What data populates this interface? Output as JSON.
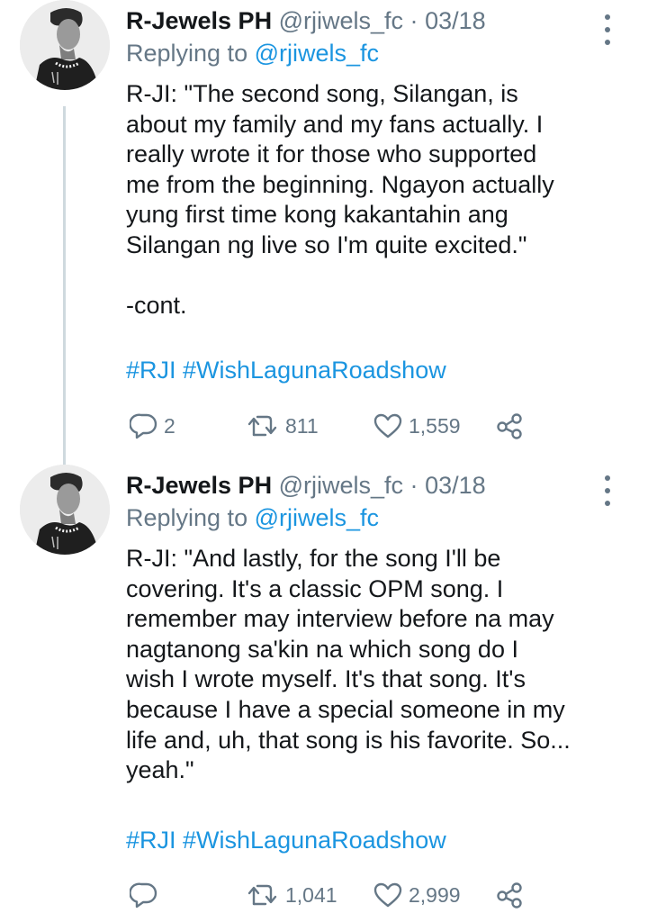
{
  "tweets": [
    {
      "author_name": "R-Jewels PH",
      "author_handle": "@rjiwels_fc",
      "separator": "·",
      "date": "03/18",
      "replying_label": "Replying to",
      "replying_handle": "@rjiwels_fc",
      "body": "R-JI: \"The second song, Silangan, is\nabout my family and my fans actually. I\nreally wrote it for those who supported\nme from the beginning. Ngayon actually\nyung first time kong kakantahin ang\nSilangan ng live so I'm quite excited.\"\n\n-cont.",
      "hashtags": "#RJI #WishLagunaRoadshow",
      "replies": "2",
      "retweets": "811",
      "likes": "1,559"
    },
    {
      "author_name": "R-Jewels PH",
      "author_handle": "@rjiwels_fc",
      "separator": "·",
      "date": "03/18",
      "replying_label": "Replying to",
      "replying_handle": "@rjiwels_fc",
      "body": "R-JI: \"And lastly, for the song I'll be\ncovering. It's a classic OPM song. I\nremember may interview before na may\nnagtanong sa'kin na which song do I\nwish I wrote myself. It's that song. It's\nbecause I have a special someone in my\nlife and, uh, that song is his favorite. So...\nyeah.\"",
      "hashtags": "#RJI #WishLagunaRoadshow",
      "replies": "",
      "retweets": "1,041",
      "likes": "2,999"
    }
  ],
  "icons": {
    "reply": "reply-icon",
    "retweet": "retweet-icon",
    "like": "heart-icon",
    "share": "share-icon",
    "more": "more-options-icon"
  },
  "colors": {
    "link": "#1b95e0",
    "muted": "#657786",
    "text": "#14171a",
    "thread_line": "#cfd9de"
  }
}
